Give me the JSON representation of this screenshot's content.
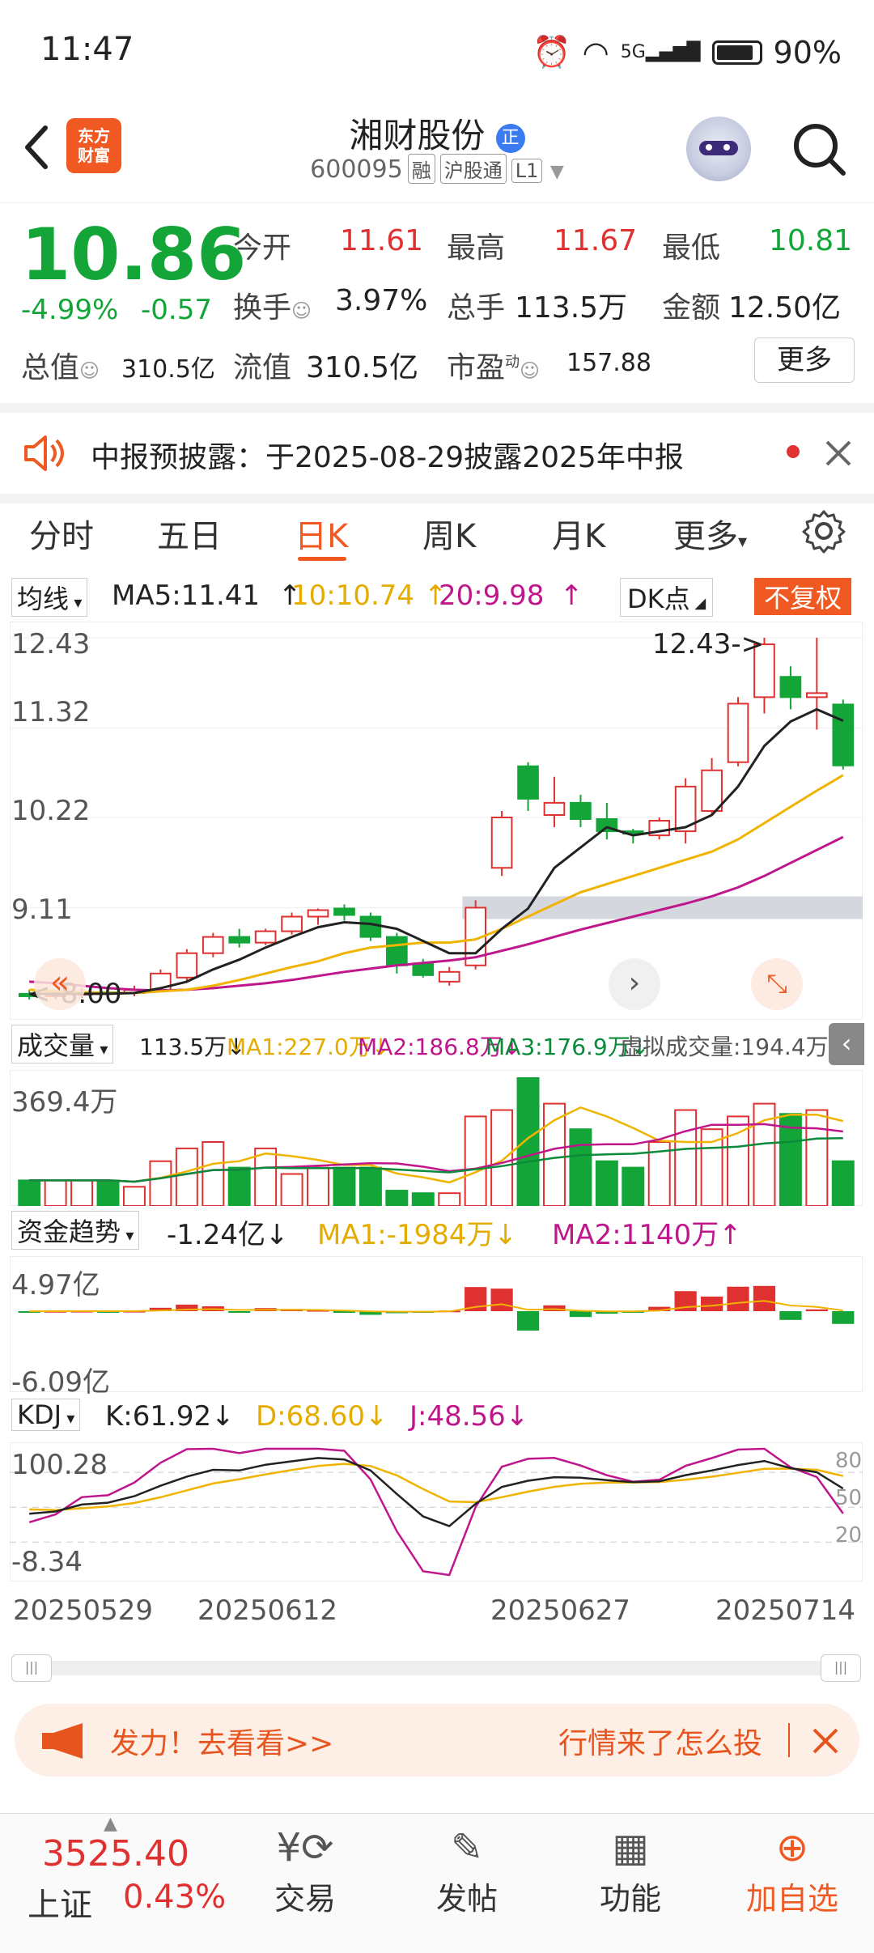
{
  "status_bar": {
    "time": "11:47",
    "network": "5G",
    "battery": "90%"
  },
  "header": {
    "logo_line1": "东方",
    "logo_line2": "财富",
    "name": "湘财股份",
    "name_badge": "正",
    "code": "600095",
    "tags": [
      "融",
      "沪股通",
      "L1"
    ]
  },
  "quote": {
    "price": "10.86",
    "change_pct": "-4.99%",
    "change": "-0.57",
    "open_label": "今开",
    "open": "11.61",
    "high_label": "最高",
    "high": "11.67",
    "low_label": "最低",
    "low": "10.81",
    "turnover_label": "换手",
    "turnover": "3.97%",
    "volume_label": "总手",
    "volume": "113.5万",
    "amount_label": "金额",
    "amount": "12.50亿",
    "mcap_label": "总值",
    "mcap": "310.5亿",
    "float_label": "流值",
    "float": "310.5亿",
    "pe_label": "市盈",
    "pe_sup": "动",
    "pe": "157.88",
    "more_label": "更多"
  },
  "notice": {
    "text": "中报预披露：于2025-08-29披露2025年中报"
  },
  "tabs": [
    "分时",
    "五日",
    "日K",
    "周K",
    "月K",
    "更多"
  ],
  "kline": {
    "ma_selector": "均线",
    "ma5": "MA5:11.41",
    "ma10": "10:10.74",
    "ma20": "20:9.98",
    "dk_label": "DK点",
    "adjust_label": "不复权",
    "axis": [
      "12.43",
      "11.32",
      "10.22",
      "9.11"
    ],
    "high_marker": "12.43->",
    "low_marker": "8.00"
  },
  "volume": {
    "selector": "成交量",
    "value": "113.5万",
    "ma1": "MA1:227.0万",
    "ma2": "MA2:186.8万",
    "ma3": "MA3:176.9万",
    "virtual": "虚拟成交量:194.4万",
    "max": "369.4万"
  },
  "fund": {
    "selector": "资金趋势",
    "value": "-1.24亿",
    "ma1": "MA1:-1984万",
    "ma2": "MA2:1140万",
    "max": "4.97亿",
    "min": "-6.09亿"
  },
  "kdj": {
    "selector": "KDJ",
    "k": "K:61.92",
    "d": "D:68.60",
    "j": "J:48.56",
    "max": "100.28",
    "min": "-8.34",
    "levels": [
      "80",
      "50",
      "20"
    ]
  },
  "dates": [
    "20250529",
    "20250612",
    "20250627",
    "20250714"
  ],
  "banner": {
    "left": "发力！去看看>>",
    "right": "行情来了怎么投"
  },
  "bottom_nav": {
    "index_value": "3525.40",
    "index_name": "上证",
    "index_pct": "0.43%",
    "trade": "交易",
    "post": "发帖",
    "func": "功能",
    "add": "加自选"
  },
  "colors": {
    "up": "#e03131",
    "down": "#13a538",
    "accent": "#f05a22",
    "ma5": "#222222",
    "ma10": "#f0b400",
    "ma20": "#c0168c"
  },
  "chart_data": {
    "type": "candlestick",
    "ohlc": [
      [
        8.05,
        8.1,
        7.98,
        8.02
      ],
      [
        8.02,
        8.08,
        7.98,
        8.04
      ],
      [
        8.04,
        8.12,
        8.0,
        8.07
      ],
      [
        8.07,
        8.12,
        8.0,
        8.06
      ],
      [
        8.06,
        8.15,
        8.02,
        8.1
      ],
      [
        8.1,
        8.35,
        8.08,
        8.3
      ],
      [
        8.25,
        8.6,
        8.2,
        8.55
      ],
      [
        8.55,
        8.8,
        8.5,
        8.75
      ],
      [
        8.75,
        8.85,
        8.62,
        8.68
      ],
      [
        8.68,
        8.85,
        8.65,
        8.82
      ],
      [
        8.82,
        9.05,
        8.78,
        9.0
      ],
      [
        9.0,
        9.1,
        8.9,
        9.08
      ],
      [
        9.1,
        9.15,
        8.95,
        9.02
      ],
      [
        9.0,
        9.05,
        8.7,
        8.75
      ],
      [
        8.75,
        8.8,
        8.3,
        8.4
      ],
      [
        8.42,
        8.48,
        8.25,
        8.28
      ],
      [
        8.2,
        8.38,
        8.15,
        8.32
      ],
      [
        8.4,
        9.2,
        8.35,
        9.11
      ],
      [
        9.6,
        10.3,
        9.5,
        10.22
      ],
      [
        10.85,
        10.9,
        10.3,
        10.45
      ],
      [
        10.25,
        10.72,
        10.1,
        10.4
      ],
      [
        10.4,
        10.5,
        10.1,
        10.2
      ],
      [
        10.2,
        10.4,
        9.95,
        10.05
      ],
      [
        10.05,
        10.08,
        9.9,
        10.02
      ],
      [
        10.0,
        10.22,
        9.95,
        10.18
      ],
      [
        10.05,
        10.7,
        9.9,
        10.6
      ],
      [
        10.3,
        10.95,
        10.25,
        10.8
      ],
      [
        10.9,
        11.7,
        10.85,
        11.62
      ],
      [
        11.7,
        12.43,
        11.5,
        12.35
      ],
      [
        11.95,
        12.08,
        11.55,
        11.7
      ],
      [
        11.7,
        12.43,
        11.3,
        11.75
      ],
      [
        11.61,
        11.67,
        10.81,
        10.86
      ]
    ],
    "ma5": [
      8.05,
      8.05,
      8.05,
      8.05,
      8.06,
      8.12,
      8.2,
      8.35,
      8.47,
      8.62,
      8.75,
      8.87,
      8.93,
      8.91,
      8.85,
      8.7,
      8.55,
      8.55,
      8.85,
      9.1,
      9.6,
      9.85,
      10.1,
      10.0,
      10.05,
      10.1,
      10.25,
      10.6,
      11.1,
      11.4,
      11.55,
      11.41
    ],
    "ma10": [
      8.1,
      8.08,
      8.07,
      8.06,
      8.06,
      8.08,
      8.1,
      8.15,
      8.22,
      8.3,
      8.38,
      8.45,
      8.55,
      8.62,
      8.65,
      8.68,
      8.68,
      8.72,
      8.85,
      9.0,
      9.15,
      9.3,
      9.4,
      9.5,
      9.6,
      9.7,
      9.8,
      9.95,
      10.15,
      10.35,
      10.55,
      10.74
    ],
    "ma20": [
      8.2,
      8.18,
      8.15,
      8.12,
      8.1,
      8.09,
      8.1,
      8.12,
      8.15,
      8.18,
      8.22,
      8.27,
      8.32,
      8.36,
      8.4,
      8.43,
      8.46,
      8.5,
      8.58,
      8.66,
      8.75,
      8.84,
      8.92,
      9.0,
      9.08,
      9.16,
      9.25,
      9.36,
      9.5,
      9.66,
      9.82,
      9.98
    ],
    "volume_rel": [
      0.2,
      0.2,
      0.2,
      0.2,
      0.15,
      0.35,
      0.45,
      0.5,
      0.3,
      0.45,
      0.25,
      0.3,
      0.3,
      0.3,
      0.12,
      0.1,
      0.1,
      0.7,
      0.75,
      1.0,
      0.8,
      0.6,
      0.35,
      0.3,
      0.5,
      0.75,
      0.6,
      0.7,
      0.8,
      0.72,
      0.75,
      0.35
    ]
  }
}
